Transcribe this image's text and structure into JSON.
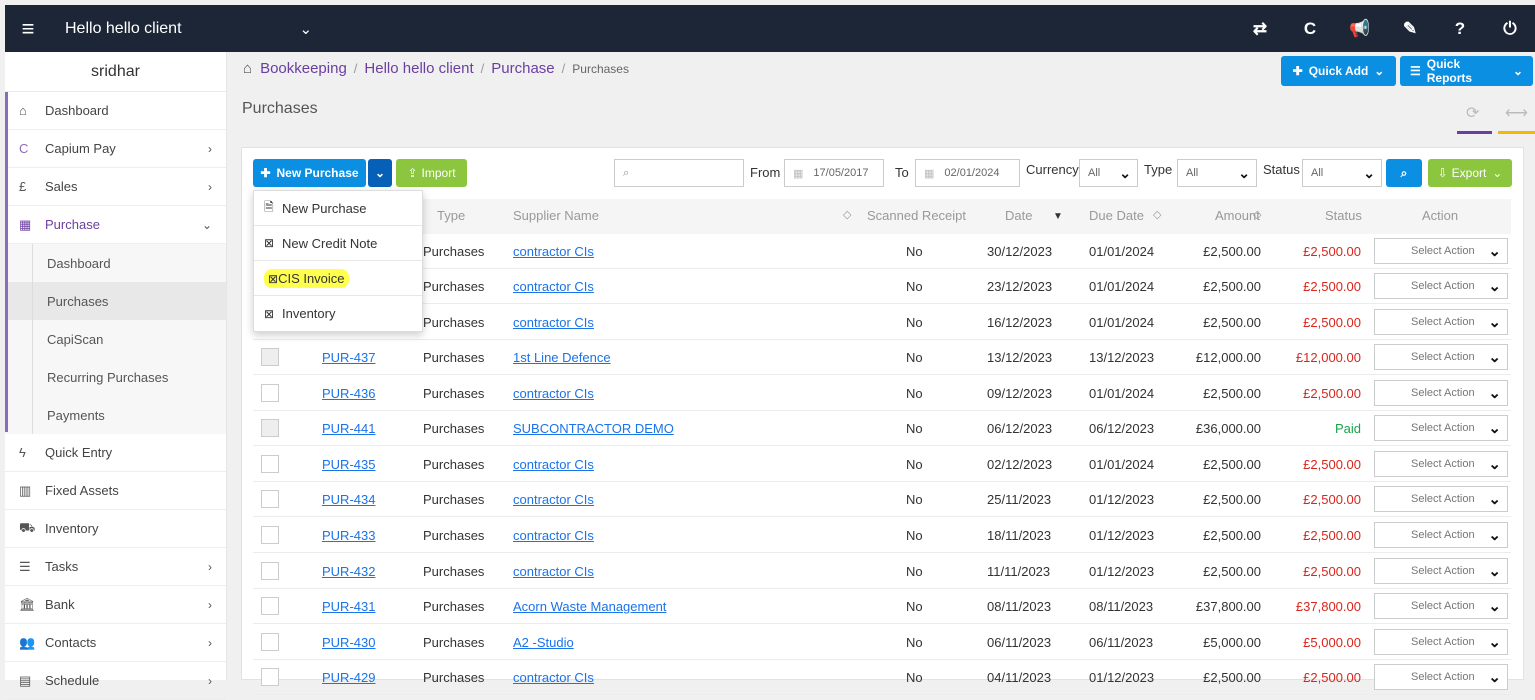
{
  "topbar": {
    "client": "Hello hello client",
    "icons": [
      "transfer-icon",
      "capium-icon",
      "megaphone-icon",
      "ticket-icon",
      "help-icon",
      "power-icon"
    ]
  },
  "sidebar": {
    "user": "sridhar",
    "items": [
      {
        "label": "Dashboard"
      },
      {
        "label": "Capium Pay"
      },
      {
        "label": "Sales"
      },
      {
        "label": "Purchase"
      },
      {
        "label": "Quick Entry"
      },
      {
        "label": "Fixed Assets"
      },
      {
        "label": "Inventory"
      },
      {
        "label": "Tasks"
      },
      {
        "label": "Bank"
      },
      {
        "label": "Contacts"
      },
      {
        "label": "Schedule"
      }
    ],
    "purchase_sub": [
      "Dashboard",
      "Purchases",
      "CapiScan",
      "Recurring Purchases",
      "Payments"
    ]
  },
  "breadcrumb": {
    "b1": "Bookkeeping",
    "b2": "Hello hello client",
    "b3": "Purchase",
    "current": "Purchases"
  },
  "header": {
    "quick_add": "Quick Add",
    "quick_reports": "Quick Reports",
    "page_title": "Purchases"
  },
  "toolbar": {
    "new_purchase": "New Purchase",
    "import": "Import",
    "from_label": "From",
    "from_date": "17/05/2017",
    "to_label": "To",
    "to_date": "02/01/2024",
    "currency_label": "Currency",
    "currency_value": "All",
    "type_label": "Type",
    "type_value": "All",
    "status_label": "Status",
    "status_value": "All",
    "export": "Export"
  },
  "dropdown": {
    "items": [
      "New Purchase",
      "New Credit Note",
      "CIS Invoice",
      "Inventory"
    ]
  },
  "table": {
    "headers": {
      "type": "Type",
      "supplier": "Supplier Name",
      "scanned": "Scanned Receipt",
      "date": "Date",
      "due": "Due Date",
      "amount": "Amount",
      "status": "Status",
      "action": "Action"
    },
    "action_placeholder": "Select Action",
    "rows": [
      {
        "ref": "",
        "type": "Purchases",
        "supplier": "contractor CIs",
        "scanned": "No",
        "date": "30/12/2023",
        "due": "01/01/2024",
        "amount": "£2,500.00",
        "status": "£2,500.00",
        "status_color": "red"
      },
      {
        "ref": "",
        "type": "Purchases",
        "supplier": "contractor CIs",
        "scanned": "No",
        "date": "23/12/2023",
        "due": "01/01/2024",
        "amount": "£2,500.00",
        "status": "£2,500.00",
        "status_color": "red"
      },
      {
        "ref": "",
        "type": "Purchases",
        "supplier": "contractor CIs",
        "scanned": "No",
        "date": "16/12/2023",
        "due": "01/01/2024",
        "amount": "£2,500.00",
        "status": "£2,500.00",
        "status_color": "red"
      },
      {
        "ref": "PUR-437",
        "type": "Purchases",
        "supplier": "1st Line Defence",
        "scanned": "No",
        "date": "13/12/2023",
        "due": "13/12/2023",
        "amount": "£12,000.00",
        "status": "£12,000.00",
        "status_color": "red"
      },
      {
        "ref": "PUR-436",
        "type": "Purchases",
        "supplier": "contractor CIs",
        "scanned": "No",
        "date": "09/12/2023",
        "due": "01/01/2024",
        "amount": "£2,500.00",
        "status": "£2,500.00",
        "status_color": "red"
      },
      {
        "ref": "PUR-441",
        "type": "Purchases",
        "supplier": "SUBCONTRACTOR DEMO",
        "scanned": "No",
        "date": "06/12/2023",
        "due": "06/12/2023",
        "amount": "£36,000.00",
        "status": "Paid",
        "status_color": "green"
      },
      {
        "ref": "PUR-435",
        "type": "Purchases",
        "supplier": "contractor CIs",
        "scanned": "No",
        "date": "02/12/2023",
        "due": "01/01/2024",
        "amount": "£2,500.00",
        "status": "£2,500.00",
        "status_color": "red"
      },
      {
        "ref": "PUR-434",
        "type": "Purchases",
        "supplier": "contractor CIs",
        "scanned": "No",
        "date": "25/11/2023",
        "due": "01/12/2023",
        "amount": "£2,500.00",
        "status": "£2,500.00",
        "status_color": "red"
      },
      {
        "ref": "PUR-433",
        "type": "Purchases",
        "supplier": "contractor CIs",
        "scanned": "No",
        "date": "18/11/2023",
        "due": "01/12/2023",
        "amount": "£2,500.00",
        "status": "£2,500.00",
        "status_color": "red"
      },
      {
        "ref": "PUR-432",
        "type": "Purchases",
        "supplier": "contractor CIs",
        "scanned": "No",
        "date": "11/11/2023",
        "due": "01/12/2023",
        "amount": "£2,500.00",
        "status": "£2,500.00",
        "status_color": "red"
      },
      {
        "ref": "PUR-431",
        "type": "Purchases",
        "supplier": "Acorn Waste Management",
        "scanned": "No",
        "date": "08/11/2023",
        "due": "08/11/2023",
        "amount": "£37,800.00",
        "status": "£37,800.00",
        "status_color": "red"
      },
      {
        "ref": "PUR-430",
        "type": "Purchases",
        "supplier": "A2 -Studio",
        "scanned": "No",
        "date": "06/11/2023",
        "due": "06/11/2023",
        "amount": "£5,000.00",
        "status": "£5,000.00",
        "status_color": "red"
      },
      {
        "ref": "PUR-429",
        "type": "Purchases",
        "supplier": "contractor CIs",
        "scanned": "No",
        "date": "04/11/2023",
        "due": "01/12/2023",
        "amount": "£2,500.00",
        "status": "£2,500.00",
        "status_color": "red"
      }
    ]
  },
  "colors": {
    "topbar": "#1c2637",
    "accent_purple": "#6b3fa0",
    "primary_blue": "#0a8fe3",
    "green_button": "#8cc63f",
    "status_red": "#d9261c",
    "status_green": "#1aa34a"
  }
}
